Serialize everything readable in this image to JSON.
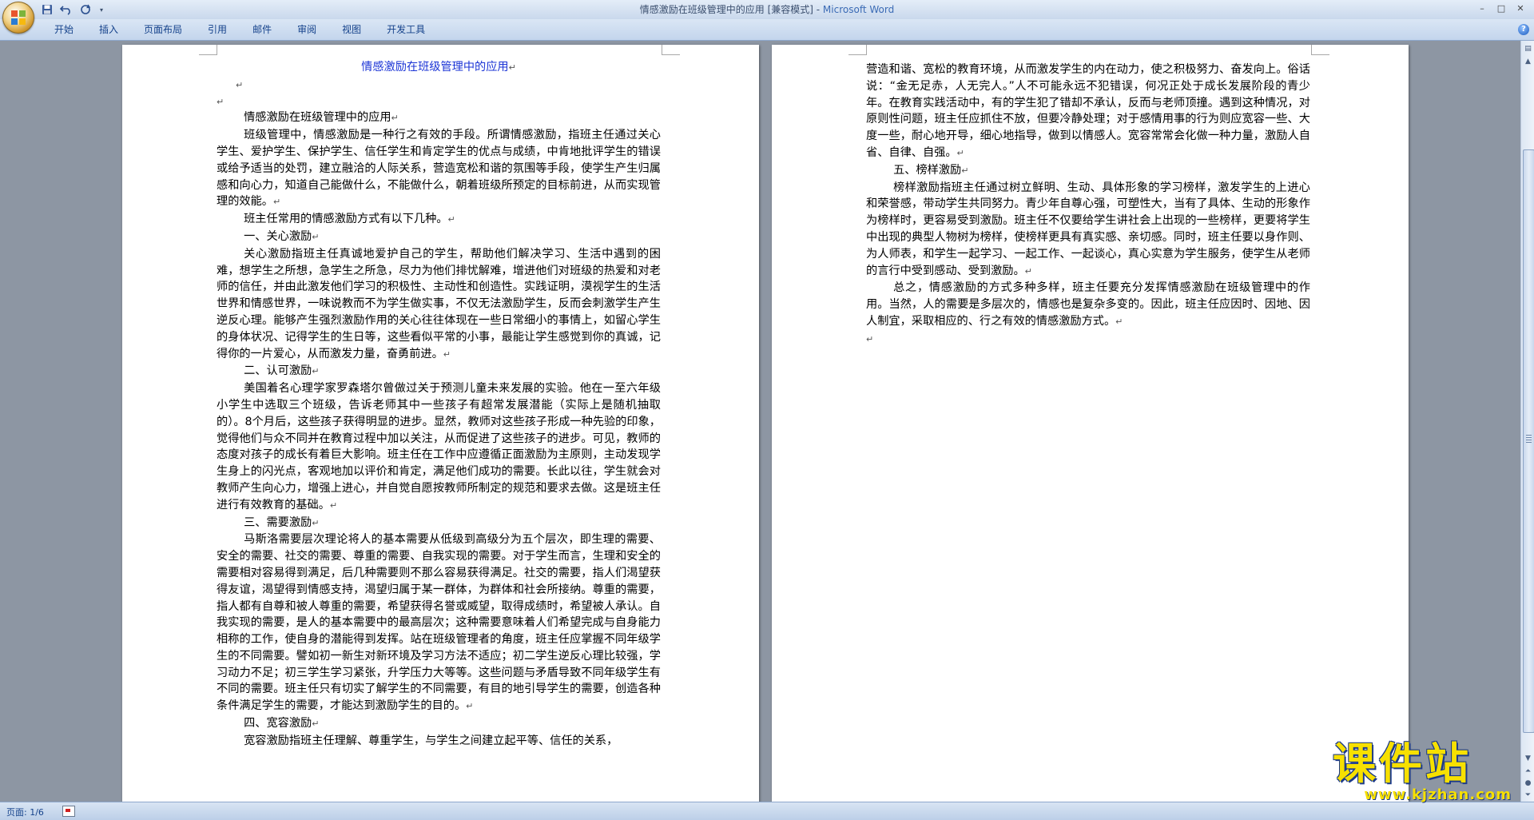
{
  "window": {
    "title": "情感激励在班级管理中的应用 [兼容模式] - ",
    "app_name": "Microsoft Word"
  },
  "quick_access": {
    "icons": [
      "save-icon",
      "undo-icon",
      "redo-icon",
      "customize-dropdown-icon"
    ]
  },
  "ribbon": {
    "tabs": [
      {
        "label": "开始"
      },
      {
        "label": "插入"
      },
      {
        "label": "页面布局"
      },
      {
        "label": "引用"
      },
      {
        "label": "邮件"
      },
      {
        "label": "审阅"
      },
      {
        "label": "视图"
      },
      {
        "label": "开发工具"
      }
    ],
    "help": "?"
  },
  "document": {
    "title": "情感激励在班级管理中的应用",
    "paragraph_mark": "↵",
    "page1": [
      "情感激励在班级管理中的应用",
      "班级管理中，情感激励是一种行之有效的手段。所谓情感激励，指班主任通过关心学生、爱护学生、保护学生、信任学生和肯定学生的优点与成绩，中肯地批评学生的错误或给予适当的处罚，建立融洽的人际关系，营造宽松和谐的氛围等手段，使学生产生归属感和向心力，知道自己能做什么，不能做什么，朝着班级所预定的目标前进，从而实现管理的效能。",
      "班主任常用的情感激励方式有以下几种。",
      "一、关心激励",
      "关心激励指班主任真诚地爱护自己的学生，帮助他们解决学习、生活中遇到的困难，想学生之所想，急学生之所急，尽力为他们排忧解难，增进他们对班级的热爱和对老师的信任，并由此激发他们学习的积极性、主动性和创造性。实践证明，漠视学生的生活世界和情感世界，一味说教而不为学生做实事，不仅无法激励学生，反而会刺激学生产生逆反心理。能够产生强烈激励作用的关心往往体现在一些日常细小的事情上，如留心学生的身体状况、记得学生的生日等，这些看似平常的小事，最能让学生感觉到你的真诚，记得你的一片爱心，从而激发力量，奋勇前进。",
      "二、认可激励",
      "美国着名心理学家罗森塔尔曾做过关于预测儿童未来发展的实验。他在一至六年级小学生中选取三个班级，告诉老师其中一些孩子有超常发展潜能（实际上是随机抽取的）。8个月后，这些孩子获得明显的进步。显然，教师对这些孩子形成一种先验的印象，觉得他们与众不同并在教育过程中加以关注，从而促进了这些孩子的进步。可见，教师的态度对孩子的成长有着巨大影响。班主任在工作中应遵循正面激励为主原则，主动发现学生身上的闪光点，客观地加以评价和肯定，满足他们成功的需要。长此以往，学生就会对教师产生向心力，增强上进心，并自觉自愿按教师所制定的规范和要求去做。这是班主任进行有效教育的基础。",
      "三、需要激励",
      "马斯洛需要层次理论将人的基本需要从低级到高级分为五个层次，即生理的需要、安全的需要、社交的需要、尊重的需要、自我实现的需要。对于学生而言，生理和安全的需要相对容易得到满足，后几种需要则不那么容易获得满足。社交的需要，指人们渴望获得友谊，渴望得到情感支持，渴望归属于某一群体，为群体和社会所接纳。尊重的需要，指人都有自尊和被人尊重的需要，希望获得名誉或威望，取得成绩时，希望被人承认。自我实现的需要，是人的基本需要中的最高层次；这种需要意味着人们希望完成与自身能力相称的工作，使自身的潜能得到发挥。站在班级管理者的角度，班主任应掌握不同年级学生的不同需要。譬如初一新生对新环境及学习方法不适应；初二学生逆反心理比较强，学习动力不足；初三学生学习紧张，升学压力大等等。这些问题与矛盾导致不同年级学生有不同的需要。班主任只有切实了解学生的不同需要，有目的地引导学生的需要，创造各种条件满足学生的需要，才能达到激励学生的目的。",
      "四、宽容激励",
      "宽容激励指班主任理解、尊重学生，与学生之间建立起平等、信任的关系，"
    ],
    "page2": [
      "营造和谐、宽松的教育环境，从而激发学生的内在动力，使之积极努力、奋发向上。俗话说：“金无足赤，人无完人。”人不可能永远不犯错误，何况正处于成长发展阶段的青少年。在教育实践活动中，有的学生犯了错却不承认，反而与老师顶撞。遇到这种情况，对原则性问题，班主任应抓住不放，但要冷静处理；对于感情用事的行为则应宽容一些、大度一些，耐心地开导，细心地指导，做到以情感人。宽容常常会化做一种力量，激励人自省、自律、自强。",
      "五、榜样激励",
      "榜样激励指班主任通过树立鲜明、生动、具体形象的学习榜样，激发学生的上进心和荣誉感，带动学生共同努力。青少年自尊心强，可塑性大，当有了具体、生动的形象作为榜样时，更容易受到激励。班主任不仅要给学生讲社会上出现的一些榜样，更要将学生中出现的典型人物树为榜样，使榜样更具有真实感、亲切感。同时，班主任要以身作则、为人师表，和学生一起学习、一起工作、一起谈心，真心实意为学生服务，使学生从老师的言行中受到感动、受到激励。",
      "总之，情感激励的方式多种多样，班主任要充分发挥情感激励在班级管理中的作用。当然，人的需要是多层次的，情感也是复杂多变的。因此，班主任应因时、因地、因人制宜，采取相应的、行之有效的情感激励方式。"
    ]
  },
  "statusbar": {
    "page_info": "页面: 1/6"
  },
  "watermark": {
    "main": "课件站",
    "url": "www.kjzhan.com"
  }
}
